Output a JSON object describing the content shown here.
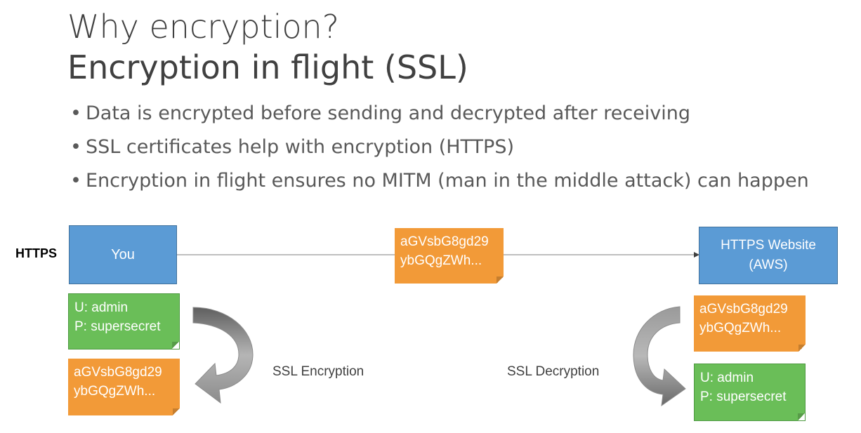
{
  "title": {
    "line1": "Why encryption?",
    "line2": "Encryption in flight (SSL)"
  },
  "bullets": [
    "Data is encrypted before sending and decrypted after receiving",
    "SSL certificates help with encryption (HTTPS)",
    "Encryption in flight ensures no MITM (man in the middle attack) can happen"
  ],
  "diagram": {
    "protocol_label": "HTTPS",
    "client_box": "You",
    "server_box": {
      "line1": "HTTPS Website",
      "line2": "(AWS)"
    },
    "ciphertext": {
      "line1": "aGVsbG8gd29",
      "line2": "ybGQgZWh..."
    },
    "credentials": {
      "user": "U: admin",
      "password": "P: supersecret"
    },
    "encryption_label": "SSL Encryption",
    "decryption_label": "SSL Decryption",
    "colors": {
      "blue": "#5b9bd5",
      "orange": "#f29a38",
      "green": "#6abe58",
      "arrow": "#a6a6a6"
    }
  }
}
